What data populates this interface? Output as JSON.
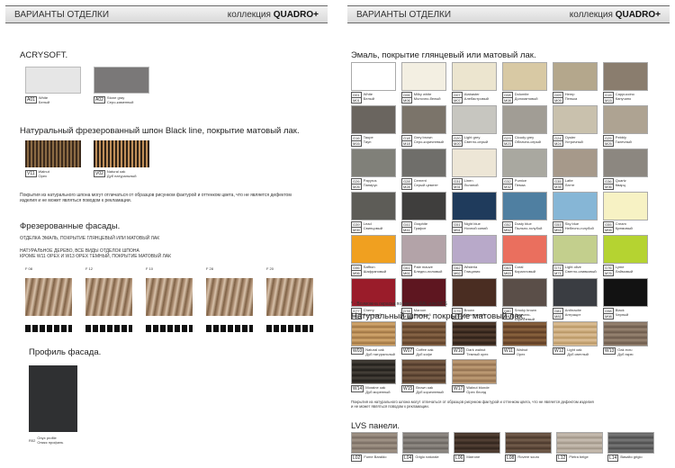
{
  "left": {
    "header": {
      "title": "ВАРИАНТЫ ОТДЕЛКИ",
      "collection_prefix": "коллекция",
      "collection_name": "QUADRO+"
    },
    "acrysoft": {
      "title": "ACRYSOFT.",
      "items": [
        {
          "code": "A01",
          "en": "White",
          "ru": "Белый",
          "color": "#e6e6e6"
        },
        {
          "code": "A02",
          "en": "Stone gray",
          "ru": "Серо-каменный",
          "color": "#7a7878"
        }
      ]
    },
    "blackline": {
      "title": "Натуральный фрезерованный шпон Black line, покрытие матовый лак.",
      "items": [
        {
          "code": "V11",
          "en": "Walnut",
          "ru": "Орех",
          "a": "#3b2a1c",
          "b": "#8b6a44"
        },
        {
          "code": "V02",
          "en": "Natural oak",
          "ru": "Дуб натуральный",
          "a": "#2f2216",
          "b": "#c08f5a"
        }
      ],
      "note": "Покрытия из натурального шпона могут отличаться от образцов рисунком фактурой и оттенком цвета, что не является дефектом изделия и не может являться поводом к рекламации."
    },
    "milled": {
      "title": "Фрезерованные фасады.",
      "note1": "ОТДЕЛКА ЭМАЛЬ, ПОКРЫТИЕ ГЛЯНЦЕВЫЙ ИЛИ МАТОВЫЙ ЛАК",
      "note2": "НАТУРАЛЬНОЕ ДЕРЕВО, ВСЕ ВИДЫ ОТДЕЛОК ШПОНА",
      "note3": "КРОМЕ W11 ОРЕХ И W13 ОРЕХ ТЕМНЫЙ, ПОКРЫТИЕ МАТОВЫЙ ЛАК",
      "items": [
        "F 08",
        "F 12",
        "F 10",
        "F 28",
        "F 20"
      ]
    },
    "profile": {
      "title": "Профиль фасада.",
      "code": "R02",
      "en": "Onyx profile",
      "ru": "Оникс профиль",
      "color": "#2f3032"
    }
  },
  "right": {
    "header": {
      "title": "ВАРИАНТЫ ОТДЕЛКИ",
      "collection_prefix": "коллекция",
      "collection_name": "QUADRO+"
    },
    "enamel": {
      "title": "Эмаль, покрытие глянцевый или матовый лак.",
      "items": [
        {
          "c1": "G01",
          "c2": "M01",
          "en": "White",
          "ru": "Белый",
          "color": "#ffffff"
        },
        {
          "c1": "G06",
          "c2": "M06",
          "en": "Milky white",
          "ru": "Молочно-белый",
          "color": "#f3efe2"
        },
        {
          "c1": "G07",
          "c2": "M07",
          "en": "Alabaster",
          "ru": "Алебастровый",
          "color": "#ece5cf"
        },
        {
          "c1": "G08",
          "c2": "M08",
          "en": "Dolomite",
          "ru": "Доломитовый",
          "color": "#d8c9a4"
        },
        {
          "c1": "G09",
          "c2": "M09",
          "en": "Hemp",
          "ru": "Пенька",
          "color": "#b4a78c"
        },
        {
          "c1": "G15",
          "c2": "M15",
          "en": "Cappuccino",
          "ru": "Капучино",
          "color": "#8a7d6e"
        },
        {
          "c1": "G16",
          "c2": "M16",
          "en": "Taupe",
          "ru": "Тауп",
          "color": "#6a655f"
        },
        {
          "c1": "G18",
          "c2": "M18",
          "en": "Grey brown",
          "ru": "Серо-коричневый",
          "color": "#7b746a"
        },
        {
          "c1": "G20",
          "c2": "M20",
          "en": "Light grey",
          "ru": "Светло-серый",
          "color": "#c7c6c0"
        },
        {
          "c1": "G23",
          "c2": "M23",
          "en": "Cloudy grey",
          "ru": "Облачно-серый",
          "color": "#a19d95"
        },
        {
          "c1": "G24",
          "c2": "M24",
          "en": "Oyster",
          "ru": "Устричный",
          "color": "#c9c1ad"
        },
        {
          "c1": "G25",
          "c2": "M25",
          "en": "Pebbly",
          "ru": "Галечный",
          "color": "#aea392"
        },
        {
          "c1": "G26",
          "c2": "M26",
          "en": "Papyrus",
          "ru": "Папирус",
          "color": "#808079"
        },
        {
          "c1": "G28",
          "c2": "M28",
          "en": "Cement",
          "ru": "Серый цемент",
          "color": "#6f6e6a"
        },
        {
          "c1": "G31",
          "c2": "M31",
          "en": "Linen",
          "ru": "Льняной",
          "color": "#ede6d6"
        },
        {
          "c1": "G32",
          "c2": "M32",
          "en": "Pumice",
          "ru": "Пемза",
          "color": "#a9a8a0"
        },
        {
          "c1": "G35",
          "c2": "M35",
          "en": "Latte",
          "ru": "Латте",
          "color": "#a6998a"
        },
        {
          "c1": "G36",
          "c2": "M36",
          "en": "Quartz",
          "ru": "Кварц",
          "color": "#8c8780"
        },
        {
          "c1": "G39",
          "c2": "M39",
          "en": "Lead",
          "ru": "Свинцовый",
          "color": "#5d5c57"
        },
        {
          "c1": "G41",
          "c2": "M41",
          "en": "Graphite",
          "ru": "Графит",
          "color": "#3f3e3d"
        },
        {
          "c1": "G51",
          "c2": "M51",
          "en": "Night blue",
          "ru": "Ночной синий",
          "color": "#1f3b5c"
        },
        {
          "c1": "G52",
          "c2": "M52",
          "en": "Dusty blue",
          "ru": "Пыльно-голубой",
          "color": "#4f7fa1"
        },
        {
          "c1": "G53",
          "c2": "M53",
          "en": "Sky blue",
          "ru": "Небесно-голубой",
          "color": "#86b6d6"
        },
        {
          "c1": "G55",
          "c2": "M55",
          "en": "Cream",
          "ru": "Кремовый",
          "color": "#f7f2c4"
        },
        {
          "c1": "G56",
          "c2": "M56",
          "en": "Saffron",
          "ru": "Шафрановый",
          "color": "#f0a020"
        },
        {
          "c1": "G61",
          "c2": "M61",
          "en": "Pale mauve",
          "ru": "Бледно-лиловый",
          "color": "#b3a3a8"
        },
        {
          "c1": "G62",
          "c2": "M62",
          "en": "Wisteria",
          "ru": "Глициния",
          "color": "#b8a9c9"
        },
        {
          "c1": "G63",
          "c2": "M63",
          "en": "Coral",
          "ru": "Коралловый",
          "color": "#ea6f5e"
        },
        {
          "c1": "G71",
          "c2": "M71",
          "en": "Light olive",
          "ru": "Светло-оливковый",
          "color": "#c3cf8d"
        },
        {
          "c1": "G76",
          "c2": "M76",
          "en": "Lyme",
          "ru": "Лаймовый",
          "color": "#b5d331"
        },
        {
          "c1": "G77",
          "c2": "M77",
          "en": "Cherry",
          "ru": "Вишневый",
          "color": "#9a1c2a"
        },
        {
          "c1": "G78",
          "c2": "M78",
          "en": "Maroon",
          "ru": "Бордовый",
          "color": "#5e1620"
        },
        {
          "c1": "G79",
          "c2": "M79",
          "en": "Brown",
          "ru": "Коричневый",
          "color": "#4a2d22"
        },
        {
          "c1": "G80",
          "c2": "M80",
          "en": "Smoky brown",
          "ru": "Дымчато-коричневый",
          "color": "#5a4e48"
        },
        {
          "c1": "G81",
          "c2": "M81",
          "en": "Anthracite",
          "ru": "Антрацит",
          "color": "#3a3d42"
        },
        {
          "c1": "G98",
          "c2": "M98",
          "en": "Black",
          "ru": "Черный",
          "color": "#121212"
        }
      ],
      "note": "* - Возможна окраска по цветам RAL или NCS"
    },
    "veneer": {
      "title": "Натуральный шпон, покрытие матовый лак.",
      "items": [
        {
          "code": "W03",
          "en": "Natural oak",
          "ru": "Дуб натуральный",
          "a": "#b38852",
          "b": "#d6ab72",
          "c": "#9c7243"
        },
        {
          "code": "W07",
          "en": "Coffee oak",
          "ru": "Дуб кофе",
          "a": "#6d4d33",
          "b": "#8c6a4b",
          "c": "#5a3e28"
        },
        {
          "code": "W10",
          "en": "Dark walnut",
          "ru": "Темный орех",
          "a": "#3a2a20",
          "b": "#5a4333",
          "c": "#2a1d15"
        },
        {
          "code": "W11",
          "en": "Walnut",
          "ru": "Орех",
          "a": "#6e4a2e",
          "b": "#8e6741",
          "c": "#5a3b23"
        },
        {
          "code": "W12",
          "en": "Light oak",
          "ru": "Дуб светлый",
          "a": "#c9a878",
          "b": "#dec19a",
          "c": "#b39263"
        },
        {
          "code": "W13",
          "en": "Oak ecru",
          "ru": "Дуб экрю",
          "a": "#7d6a5a",
          "b": "#9a8775",
          "c": "#6b594a"
        },
        {
          "code": "W14",
          "en": "Moraine oak",
          "ru": "Дуб моренный",
          "a": "#2e2a25",
          "b": "#48433c",
          "c": "#1f1c19"
        },
        {
          "code": "W15",
          "en": "Brown oak",
          "ru": "Дуб коричневый",
          "a": "#5e4634",
          "b": "#7b6049",
          "c": "#4b3627"
        },
        {
          "code": "W17",
          "en": "Walnut blonde",
          "ru": "Орех блонд",
          "a": "#a4825e",
          "b": "#c29f78",
          "c": "#8e6e4e"
        }
      ],
      "note": "Покрытия из натурального шпона могут отличаться от образцов рисунком фактурой и оттенком цвета, что не является дефектом изделия и не может являться поводом к рекламации."
    },
    "lvs": {
      "title": "LVS панели.",
      "items": [
        {
          "code": "L02",
          "name": "Fume Baraldo",
          "a": "#8a7d72",
          "b": "#a39689",
          "c": "#766a60"
        },
        {
          "code": "L04",
          "name": "Grigio naturale",
          "a": "#7a7570",
          "b": "#938d87",
          "c": "#66615c"
        },
        {
          "code": "L06",
          "name": "Marrone",
          "a": "#3e2f26",
          "b": "#574438",
          "c": "#2f231c"
        },
        {
          "code": "L08",
          "name": "Rovere scuro",
          "a": "#5b4637",
          "b": "#75604f",
          "c": "#48372b"
        },
        {
          "code": "L12",
          "name": "Pietra beige",
          "a": "#b2a79a",
          "b": "#c9bfb3",
          "c": "#9c9285"
        },
        {
          "code": "L14",
          "name": "Basalto grigio",
          "a": "#5e5e5e",
          "b": "#7a7a7a",
          "c": "#4a4a4a"
        }
      ]
    }
  }
}
